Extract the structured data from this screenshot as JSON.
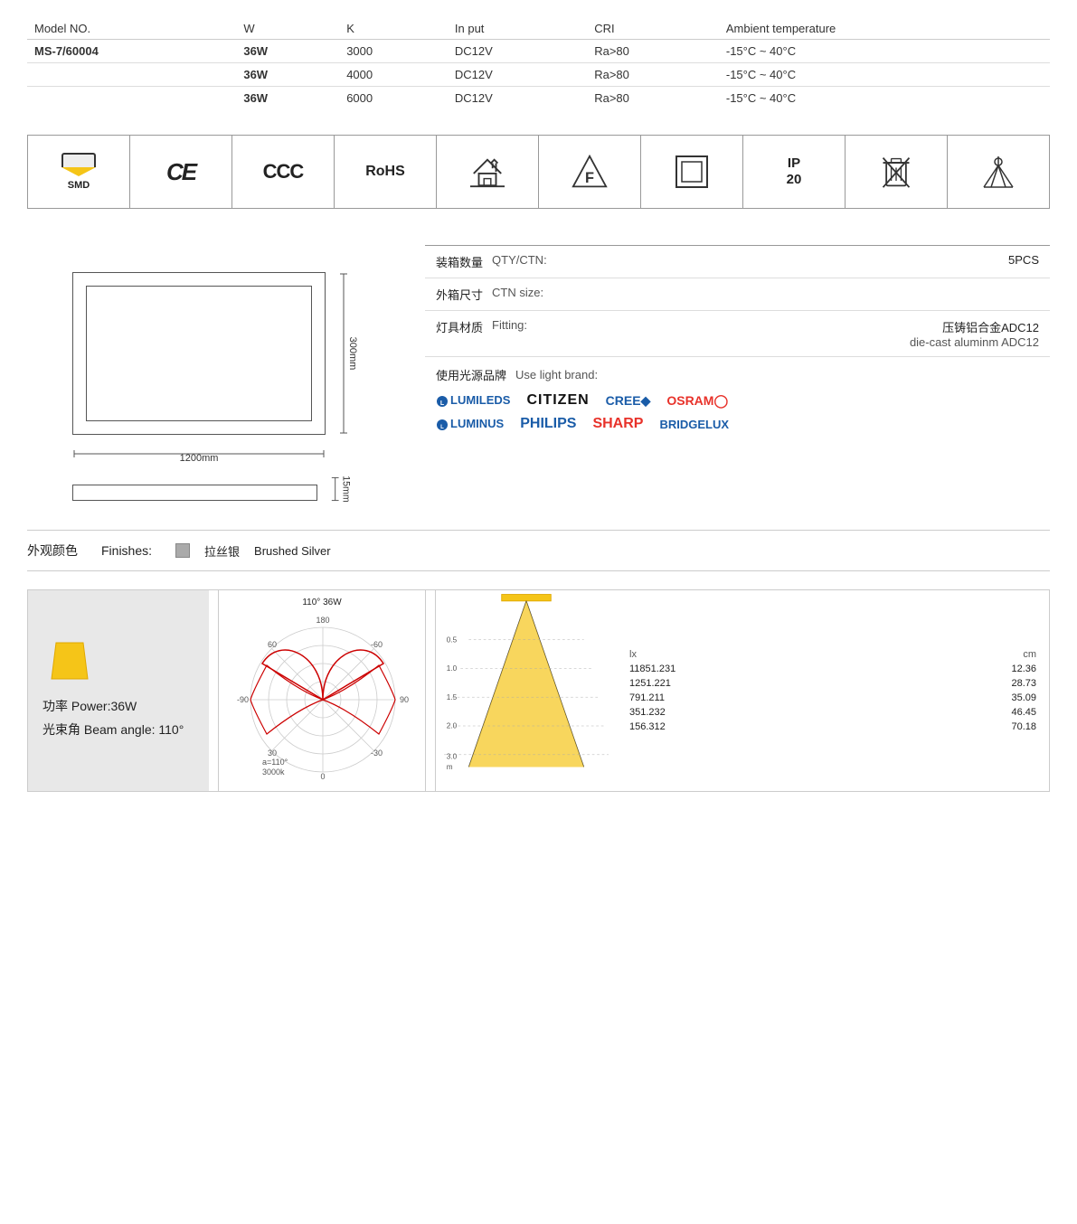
{
  "table": {
    "headers": [
      "Model NO.",
      "W",
      "K",
      "In put",
      "CRI",
      "Ambient temperature"
    ],
    "rows": [
      {
        "model": "MS-7/60004",
        "w": "36W",
        "k": "3000",
        "input": "DC12V",
        "cri": "Ra>80",
        "temp": "-15°C ~ 40°C",
        "bold_model": true
      },
      {
        "model": "",
        "w": "36W",
        "k": "4000",
        "input": "DC12V",
        "cri": "Ra>80",
        "temp": "-15°C ~ 40°C",
        "bold_model": false
      },
      {
        "model": "",
        "w": "36W",
        "k": "6000",
        "input": "DC12V",
        "cri": "Ra>80",
        "temp": "-15°C ~ 40°C",
        "bold_model": false
      }
    ]
  },
  "certifications": [
    "SMD",
    "CE",
    "CCC",
    "RoHS",
    "House",
    "F-class",
    "Square",
    "IP20",
    "Waste",
    "LightDist"
  ],
  "diagram": {
    "width_label": "1200mm",
    "height_label": "300mm",
    "thickness_label": "15mm"
  },
  "info": {
    "qty_cn": "装箱数量",
    "qty_en": "QTY/CTN:",
    "qty_value": "5PCS",
    "ctn_cn": "外箱尺寸",
    "ctn_en": "CTN size:",
    "ctn_value": "",
    "fitting_cn": "灯具材质",
    "fitting_en": "Fitting:",
    "fitting_value_cn": "压铸铝合金ADC12",
    "fitting_value_en": "die-cast aluminm ADC12",
    "brand_cn": "使用光源品牌",
    "brand_en": "Use light brand:"
  },
  "brands_row1": [
    "LUMILEDS",
    "CITIZEN",
    "CREE",
    "OSRAM"
  ],
  "brands_row2": [
    "LUMINUS",
    "PHILIPS",
    "SHARP",
    "BRIDGELUX"
  ],
  "finish": {
    "cn": "外观颜色",
    "en": "Finishes:",
    "color_cn": "拉丝银",
    "color_en": "Brushed Silver"
  },
  "power": {
    "label_cn": "功率",
    "label_en": "Power:36W",
    "beam_cn": "光束角",
    "beam_en": "Beam angle: 110°"
  },
  "polar": {
    "title": "110°  36W",
    "sub1": "180",
    "sub2": "90",
    "sub3": "-90",
    "angle_label": "a=110°",
    "kelvin_label": "3000k"
  },
  "lux_data": [
    {
      "m": "0.5",
      "lx": "11851.231",
      "cm": "12.36"
    },
    {
      "m": "1.0",
      "lx": "1251.221",
      "cm": "28.73"
    },
    {
      "m": "1.5",
      "lx": "791.211",
      "cm": "35.09"
    },
    {
      "m": "2.0",
      "lx": "351.232",
      "cm": "46.45"
    },
    {
      "m": "3.0",
      "lx": "156.312",
      "cm": "70.18"
    }
  ],
  "lux_headers": {
    "m": "m",
    "lx": "lx",
    "cm": "cm"
  }
}
